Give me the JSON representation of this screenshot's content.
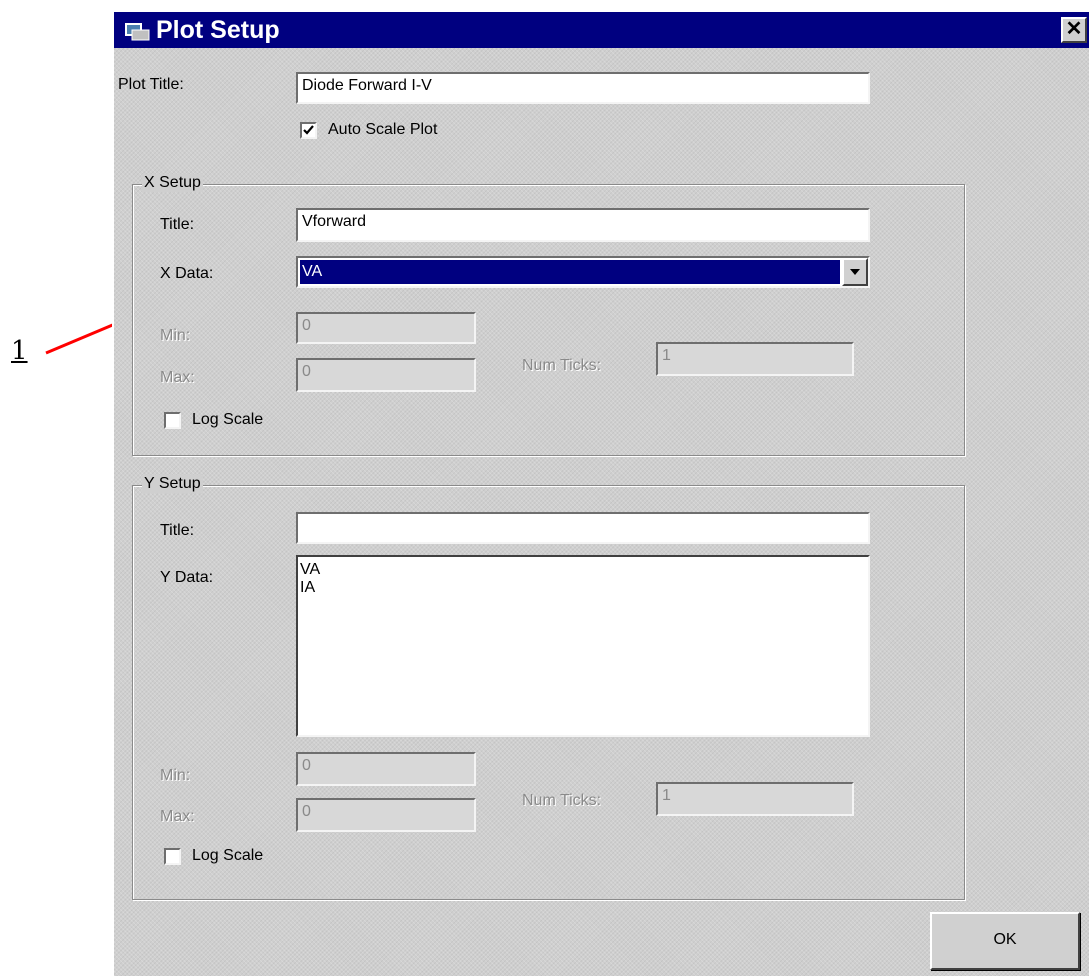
{
  "window": {
    "title": "Plot Setup",
    "close_label": "✕"
  },
  "plot": {
    "title_label": "Plot Title:",
    "title_value": "Diode Forward I-V",
    "auto_scale_label": "Auto Scale Plot",
    "auto_scale_checked": true
  },
  "x_setup": {
    "group_label": "X Setup",
    "title_label": "Title:",
    "title_value": "Vforward",
    "data_label": "X Data:",
    "data_selected": "VA",
    "min_label": "Min:",
    "min_value": "0",
    "max_label": "Max:",
    "max_value": "0",
    "ticks_label": "Num Ticks:",
    "ticks_value": "1",
    "log_label": "Log Scale",
    "log_checked": false
  },
  "y_setup": {
    "group_label": "Y Setup",
    "title_label": "Title:",
    "title_value": "",
    "data_label": "Y Data:",
    "data_items": [
      "VA",
      "IA"
    ],
    "min_label": "Min:",
    "min_value": "0",
    "max_label": "Max:",
    "max_value": "0",
    "ticks_label": "Num Ticks:",
    "ticks_value": "1",
    "log_label": "Log Scale",
    "log_checked": false
  },
  "buttons": {
    "ok_label": "OK"
  },
  "annotation": {
    "callout_number": "1",
    "arrow_color": "#ff0000"
  },
  "colors": {
    "titlebar": "#000080",
    "dialog_bg": "#cfcfcf",
    "selection": "#000080"
  }
}
